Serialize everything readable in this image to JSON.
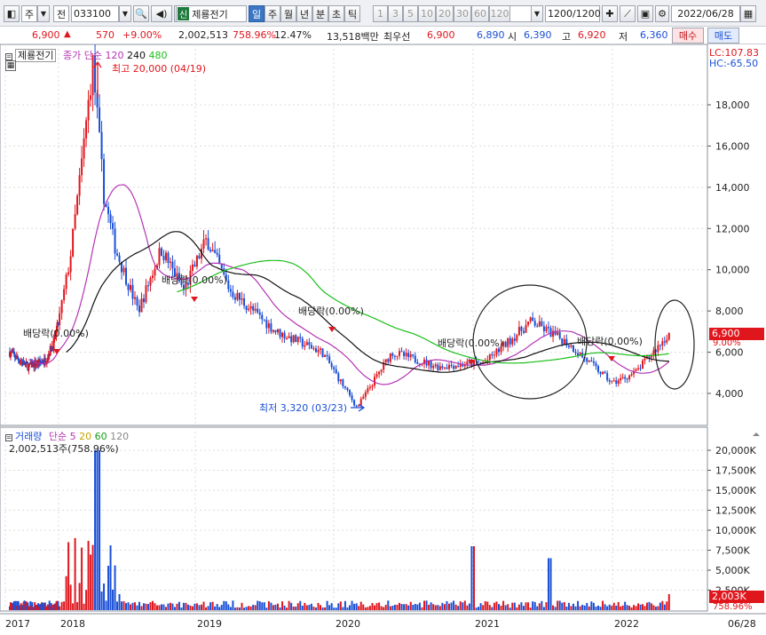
{
  "toolbar": {
    "market": "주",
    "type": "전",
    "code": "033100",
    "stock_badge": "신",
    "stock_name": "제룡전기",
    "periods": [
      "일",
      "주",
      "월",
      "년",
      "분",
      "초",
      "틱"
    ],
    "active_period": "일",
    "minutes": [
      "1",
      "3",
      "5",
      "10",
      "20",
      "30",
      "60",
      "120"
    ],
    "count": "1200",
    "count_total": "/1200",
    "date": "2022/06/28"
  },
  "quote": {
    "price": "6,900",
    "arrow": "▲",
    "change": "570",
    "change_pct": "+9.00%",
    "volume": "2,002,513",
    "vol_ratio": "758.96%",
    "turnover": "12.47%",
    "amount": "13,518백만",
    "best_label": "최우선",
    "best_ask": "6,900",
    "best_bid": "6,890",
    "open_label": "시",
    "open": "6,390",
    "high_label": "고",
    "high": "6,920",
    "low_label": "저",
    "low": "6,360",
    "buy_label": "매수",
    "sell_label": "매도"
  },
  "price_panel": {
    "legend_name": "제룡전기",
    "legend_ma": "종가 단순",
    "ma_periods": [
      "120",
      "240",
      "480"
    ],
    "lc": "LC:107.83",
    "hc": "HC:-65.50",
    "current_tag": "6,900",
    "current_pct": "9.00%",
    "high_note": "최고 20,000 (04/19)",
    "low_note": "최저 3,320 (03/23)",
    "dividend_label": "배당락(0.00%)"
  },
  "volume_panel": {
    "legend_name": "거래량",
    "legend_ma": "단순",
    "ma_periods": [
      "5",
      "20",
      "60",
      "120"
    ],
    "value_line": "2,002,513주(758.96%)",
    "current_tag": "2,003K",
    "current_pct": "758.96%"
  },
  "colors": {
    "up": "#e0161d",
    "down": "#1a4fd6",
    "ma120": "#b434b4",
    "ma240": "#111111",
    "ma480": "#1bbf1b",
    "selected": "#3b76c4"
  },
  "chart_data": {
    "type": "candlestick",
    "x_ticks": [
      "2017",
      "2018",
      "2019",
      "2020",
      "2021",
      "2022",
      "06/28"
    ],
    "price_axis": [
      "4,000",
      "6,000",
      "8,000",
      "10,000",
      "12,000",
      "14,000",
      "16,000",
      "18,000"
    ],
    "price_range": [
      3000,
      21000
    ],
    "price_series": [
      {
        "date": "2017-02",
        "price": 6000
      },
      {
        "date": "2017-06",
        "price": 5300
      },
      {
        "date": "2017-10",
        "price": 5600
      },
      {
        "date": "2017-12",
        "price": 6500
      },
      {
        "date": "2018-01",
        "price": 7500
      },
      {
        "date": "2018-02",
        "price": 10500
      },
      {
        "date": "2018-03",
        "price": 15000
      },
      {
        "date": "2018-04",
        "price": 20000
      },
      {
        "date": "2018-05",
        "price": 13500
      },
      {
        "date": "2018-06",
        "price": 11000
      },
      {
        "date": "2018-08",
        "price": 8000
      },
      {
        "date": "2018-10",
        "price": 11000
      },
      {
        "date": "2018-12",
        "price": 9000
      },
      {
        "date": "2019-02",
        "price": 11500
      },
      {
        "date": "2019-04",
        "price": 9000
      },
      {
        "date": "2019-08",
        "price": 7000
      },
      {
        "date": "2019-12",
        "price": 6000
      },
      {
        "date": "2020-03",
        "price": 3320
      },
      {
        "date": "2020-06",
        "price": 6000
      },
      {
        "date": "2020-10",
        "price": 5300
      },
      {
        "date": "2021-02",
        "price": 5500
      },
      {
        "date": "2021-06",
        "price": 7500
      },
      {
        "date": "2021-09",
        "price": 6500
      },
      {
        "date": "2022-01",
        "price": 4500
      },
      {
        "date": "2022-03",
        "price": 5000
      },
      {
        "date": "2022-06",
        "price": 6900
      }
    ],
    "volume_axis": [
      "2,500K",
      "5,000K",
      "7,500K",
      "10,000K",
      "12,500K",
      "15,000K",
      "17,500K",
      "20,000K"
    ],
    "volume_range": [
      0,
      21000
    ]
  }
}
